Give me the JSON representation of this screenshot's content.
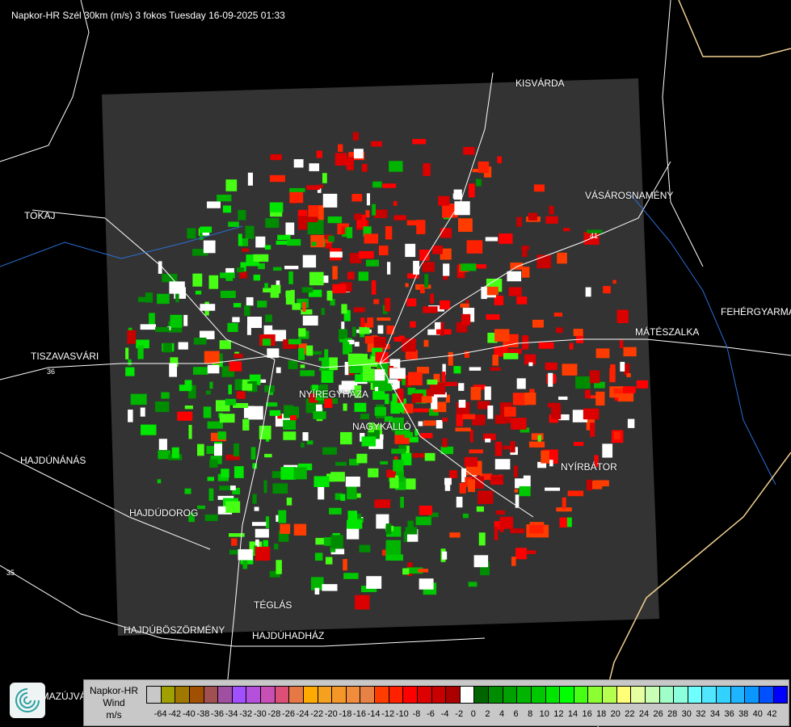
{
  "title": "Napkor-HR Szél 30km (m/s) 3 fokos Tuesday 16-09-2025 01:33",
  "cities": [
    {
      "name": "KISVÁRDA"
    },
    {
      "name": "VÁSÁROSNAMÉNY"
    },
    {
      "name": "TOKAJ"
    },
    {
      "name": "FEHÉRGYARMAT"
    },
    {
      "name": "MÁTÉSZALKA"
    },
    {
      "name": "TISZAVASVÁRI"
    },
    {
      "name": "NYÍREGYHÁZA"
    },
    {
      "name": "NAGYKÁLLÓ"
    },
    {
      "name": "NYÍRBÁTOR"
    },
    {
      "name": "HAJDÚNÁNÁS"
    },
    {
      "name": "HAJDÚDOROG"
    },
    {
      "name": "TÉGLÁS"
    },
    {
      "name": "HAJDÚBÖSZÖRMÉNY"
    },
    {
      "name": "HAJDÚHADHÁZ"
    },
    {
      "name": "BALMAZÚJVÁROS"
    }
  ],
  "road_numbers": [
    "36",
    "41",
    "35"
  ],
  "legend": {
    "name_line1": "Napkor-HR",
    "name_line2": "Wind",
    "unit": "m/s",
    "labels": [
      "-64",
      "-42",
      "-40",
      "-38",
      "-36",
      "-34",
      "-32",
      "-30",
      "-28",
      "-26",
      "-24",
      "-22",
      "-20",
      "-18",
      "-16",
      "-14",
      "-12",
      "-10",
      "-8",
      "-6",
      "-4",
      "-2",
      "0",
      "2",
      "4",
      "6",
      "8",
      "10",
      "12",
      "14",
      "16",
      "18",
      "20",
      "22",
      "24",
      "26",
      "28",
      "30",
      "32",
      "34",
      "36",
      "38",
      "40",
      "42"
    ],
    "colors": [
      "#c8c8c8",
      "#a0a000",
      "#a07800",
      "#a05000",
      "#a05050",
      "#a050a0",
      "#a050ff",
      "#b450dc",
      "#c850b4",
      "#dc5078",
      "#e67846",
      "#ffaa00",
      "#f5a01e",
      "#f59628",
      "#f08c3c",
      "#e68246",
      "#ff3c00",
      "#ff2000",
      "#ff0000",
      "#dc0000",
      "#c80000",
      "#aa0000",
      "#ffffff",
      "#006400",
      "#008c00",
      "#00a000",
      "#00b400",
      "#00c800",
      "#00e600",
      "#00ff00",
      "#46ff14",
      "#8cff32",
      "#b4ff50",
      "#ffff78",
      "#e6ffa0",
      "#c8ffb4",
      "#a0ffc8",
      "#8cffdc",
      "#6effff",
      "#50e6ff",
      "#32d2ff",
      "#1eb4ff",
      "#0a96ff",
      "#0050ff",
      "#0000ff"
    ]
  }
}
